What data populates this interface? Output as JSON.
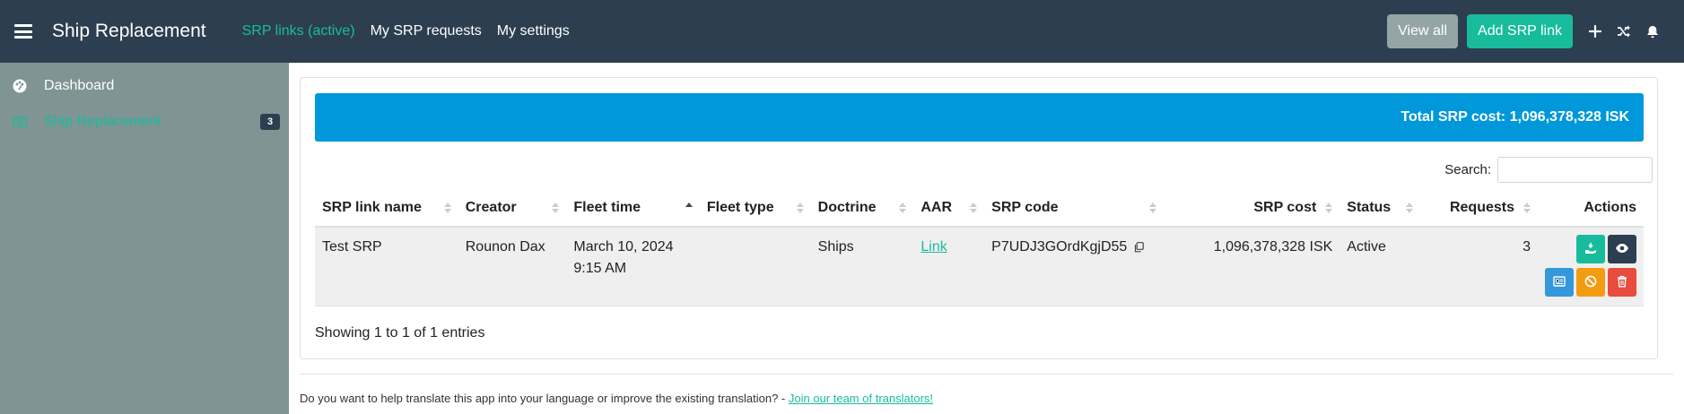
{
  "navbar": {
    "brand": "Ship Replacement",
    "links": [
      {
        "label": "SRP links (active)",
        "active": true
      },
      {
        "label": "My SRP requests",
        "active": false
      },
      {
        "label": "My settings",
        "active": false
      }
    ],
    "view_all_label": "View all",
    "add_srp_link_label": "Add SRP link",
    "icons": [
      "plus-icon",
      "shuffle-icon",
      "bell-icon"
    ]
  },
  "sidebar": {
    "items": [
      {
        "label": "Dashboard",
        "icon": "palette-icon",
        "active": false
      },
      {
        "label": "Ship Replacement",
        "icon": "money-bill-icon",
        "active": true,
        "badge": "3"
      }
    ]
  },
  "summary": {
    "total_label": "Total SRP cost: 1,096,378,328 ISK"
  },
  "search": {
    "label": "Search:",
    "value": "",
    "placeholder": ""
  },
  "table": {
    "columns": [
      "SRP link name",
      "Creator",
      "Fleet time",
      "Fleet type",
      "Doctrine",
      "AAR",
      "SRP code",
      "SRP cost",
      "Status",
      "Requests",
      "Actions"
    ],
    "sorted_column": "Fleet time",
    "sorted_direction": "asc",
    "rows": [
      {
        "srp_link_name": "Test SRP",
        "creator": "Rounon Dax",
        "fleet_time_date": "March 10, 2024",
        "fleet_time_time": "9:15 AM",
        "fleet_type": "",
        "doctrine": "Ships",
        "aar": "Link",
        "srp_code": "P7UDJ3GOrdKgjD55",
        "srp_cost": "1,096,378,328 ISK",
        "status": "Active",
        "requests": "3"
      }
    ]
  },
  "pagination": {
    "info": "Showing 1 to 1 of 1 entries"
  },
  "footer": {
    "text": "Do you want to help translate this app into your language or improve the existing translation? - ",
    "link_label": "Join our team of translators!"
  },
  "colors": {
    "navbar_bg": "#2c3e50",
    "sidebar_bg": "#7f9493",
    "accent": "#18bc9c",
    "info": "#0098db",
    "warning": "#f39c12",
    "danger": "#e74c3c"
  }
}
